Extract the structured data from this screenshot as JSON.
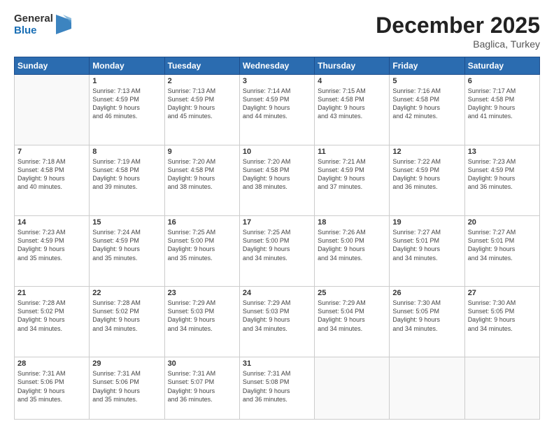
{
  "header": {
    "logo_line1": "General",
    "logo_line2": "Blue",
    "month": "December 2025",
    "location": "Baglica, Turkey"
  },
  "days_of_week": [
    "Sunday",
    "Monday",
    "Tuesday",
    "Wednesday",
    "Thursday",
    "Friday",
    "Saturday"
  ],
  "weeks": [
    [
      {
        "day": "",
        "info": ""
      },
      {
        "day": "1",
        "info": "Sunrise: 7:13 AM\nSunset: 4:59 PM\nDaylight: 9 hours\nand 46 minutes."
      },
      {
        "day": "2",
        "info": "Sunrise: 7:13 AM\nSunset: 4:59 PM\nDaylight: 9 hours\nand 45 minutes."
      },
      {
        "day": "3",
        "info": "Sunrise: 7:14 AM\nSunset: 4:59 PM\nDaylight: 9 hours\nand 44 minutes."
      },
      {
        "day": "4",
        "info": "Sunrise: 7:15 AM\nSunset: 4:58 PM\nDaylight: 9 hours\nand 43 minutes."
      },
      {
        "day": "5",
        "info": "Sunrise: 7:16 AM\nSunset: 4:58 PM\nDaylight: 9 hours\nand 42 minutes."
      },
      {
        "day": "6",
        "info": "Sunrise: 7:17 AM\nSunset: 4:58 PM\nDaylight: 9 hours\nand 41 minutes."
      }
    ],
    [
      {
        "day": "7",
        "info": "Sunrise: 7:18 AM\nSunset: 4:58 PM\nDaylight: 9 hours\nand 40 minutes."
      },
      {
        "day": "8",
        "info": "Sunrise: 7:19 AM\nSunset: 4:58 PM\nDaylight: 9 hours\nand 39 minutes."
      },
      {
        "day": "9",
        "info": "Sunrise: 7:20 AM\nSunset: 4:58 PM\nDaylight: 9 hours\nand 38 minutes."
      },
      {
        "day": "10",
        "info": "Sunrise: 7:20 AM\nSunset: 4:58 PM\nDaylight: 9 hours\nand 38 minutes."
      },
      {
        "day": "11",
        "info": "Sunrise: 7:21 AM\nSunset: 4:59 PM\nDaylight: 9 hours\nand 37 minutes."
      },
      {
        "day": "12",
        "info": "Sunrise: 7:22 AM\nSunset: 4:59 PM\nDaylight: 9 hours\nand 36 minutes."
      },
      {
        "day": "13",
        "info": "Sunrise: 7:23 AM\nSunset: 4:59 PM\nDaylight: 9 hours\nand 36 minutes."
      }
    ],
    [
      {
        "day": "14",
        "info": "Sunrise: 7:23 AM\nSunset: 4:59 PM\nDaylight: 9 hours\nand 35 minutes."
      },
      {
        "day": "15",
        "info": "Sunrise: 7:24 AM\nSunset: 4:59 PM\nDaylight: 9 hours\nand 35 minutes."
      },
      {
        "day": "16",
        "info": "Sunrise: 7:25 AM\nSunset: 5:00 PM\nDaylight: 9 hours\nand 35 minutes."
      },
      {
        "day": "17",
        "info": "Sunrise: 7:25 AM\nSunset: 5:00 PM\nDaylight: 9 hours\nand 34 minutes."
      },
      {
        "day": "18",
        "info": "Sunrise: 7:26 AM\nSunset: 5:00 PM\nDaylight: 9 hours\nand 34 minutes."
      },
      {
        "day": "19",
        "info": "Sunrise: 7:27 AM\nSunset: 5:01 PM\nDaylight: 9 hours\nand 34 minutes."
      },
      {
        "day": "20",
        "info": "Sunrise: 7:27 AM\nSunset: 5:01 PM\nDaylight: 9 hours\nand 34 minutes."
      }
    ],
    [
      {
        "day": "21",
        "info": "Sunrise: 7:28 AM\nSunset: 5:02 PM\nDaylight: 9 hours\nand 34 minutes."
      },
      {
        "day": "22",
        "info": "Sunrise: 7:28 AM\nSunset: 5:02 PM\nDaylight: 9 hours\nand 34 minutes."
      },
      {
        "day": "23",
        "info": "Sunrise: 7:29 AM\nSunset: 5:03 PM\nDaylight: 9 hours\nand 34 minutes."
      },
      {
        "day": "24",
        "info": "Sunrise: 7:29 AM\nSunset: 5:03 PM\nDaylight: 9 hours\nand 34 minutes."
      },
      {
        "day": "25",
        "info": "Sunrise: 7:29 AM\nSunset: 5:04 PM\nDaylight: 9 hours\nand 34 minutes."
      },
      {
        "day": "26",
        "info": "Sunrise: 7:30 AM\nSunset: 5:05 PM\nDaylight: 9 hours\nand 34 minutes."
      },
      {
        "day": "27",
        "info": "Sunrise: 7:30 AM\nSunset: 5:05 PM\nDaylight: 9 hours\nand 34 minutes."
      }
    ],
    [
      {
        "day": "28",
        "info": "Sunrise: 7:31 AM\nSunset: 5:06 PM\nDaylight: 9 hours\nand 35 minutes."
      },
      {
        "day": "29",
        "info": "Sunrise: 7:31 AM\nSunset: 5:06 PM\nDaylight: 9 hours\nand 35 minutes."
      },
      {
        "day": "30",
        "info": "Sunrise: 7:31 AM\nSunset: 5:07 PM\nDaylight: 9 hours\nand 36 minutes."
      },
      {
        "day": "31",
        "info": "Sunrise: 7:31 AM\nSunset: 5:08 PM\nDaylight: 9 hours\nand 36 minutes."
      },
      {
        "day": "",
        "info": ""
      },
      {
        "day": "",
        "info": ""
      },
      {
        "day": "",
        "info": ""
      }
    ]
  ]
}
